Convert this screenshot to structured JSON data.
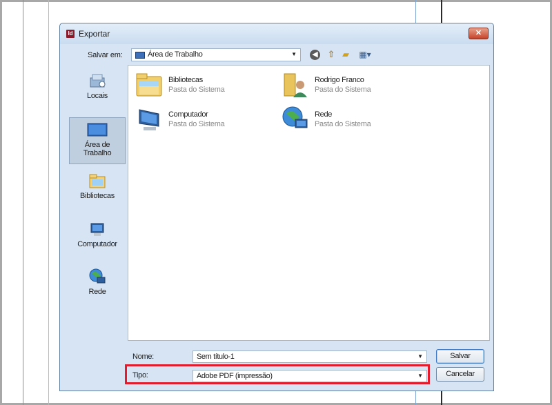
{
  "dialog": {
    "title": "Exportar",
    "app_icon": "Id",
    "close_glyph": "✕"
  },
  "toolbar": {
    "save_in_label": "Salvar em:",
    "save_in_value": "Área de Trabalho",
    "back_icon": "back-arrow-icon",
    "up_icon": "up-folder-icon",
    "new_folder_icon": "new-folder-icon",
    "view_icon": "view-menu-icon"
  },
  "places": [
    {
      "label": "Locais",
      "icon": "recent-places-icon"
    },
    {
      "label_line1": "Área de",
      "label_line2": "Trabalho",
      "icon": "desktop-icon",
      "selected": true
    },
    {
      "label": "Bibliotecas",
      "icon": "libraries-icon"
    },
    {
      "label": "Computador",
      "icon": "computer-icon"
    },
    {
      "label": "Rede",
      "icon": "network-icon"
    }
  ],
  "items": [
    {
      "name": "Bibliotecas",
      "sub": "Pasta do Sistema",
      "icon": "libraries-folder-icon"
    },
    {
      "name": "Rodrigo Franco",
      "sub": "Pasta do Sistema",
      "icon": "user-folder-icon"
    },
    {
      "name": "Computador",
      "sub": "Pasta do Sistema",
      "icon": "computer-icon"
    },
    {
      "name": "Rede",
      "sub": "Pasta do Sistema",
      "icon": "network-icon"
    }
  ],
  "form": {
    "name_label": "Nome:",
    "name_value": "Sem título-1",
    "type_label": "Tipo:",
    "type_value": "Adobe PDF (impressão)",
    "save_button": "Salvar",
    "cancel_button": "Cancelar"
  },
  "colors": {
    "highlight": "#e21b2d",
    "dialog_bg": "#d6e4f4"
  }
}
